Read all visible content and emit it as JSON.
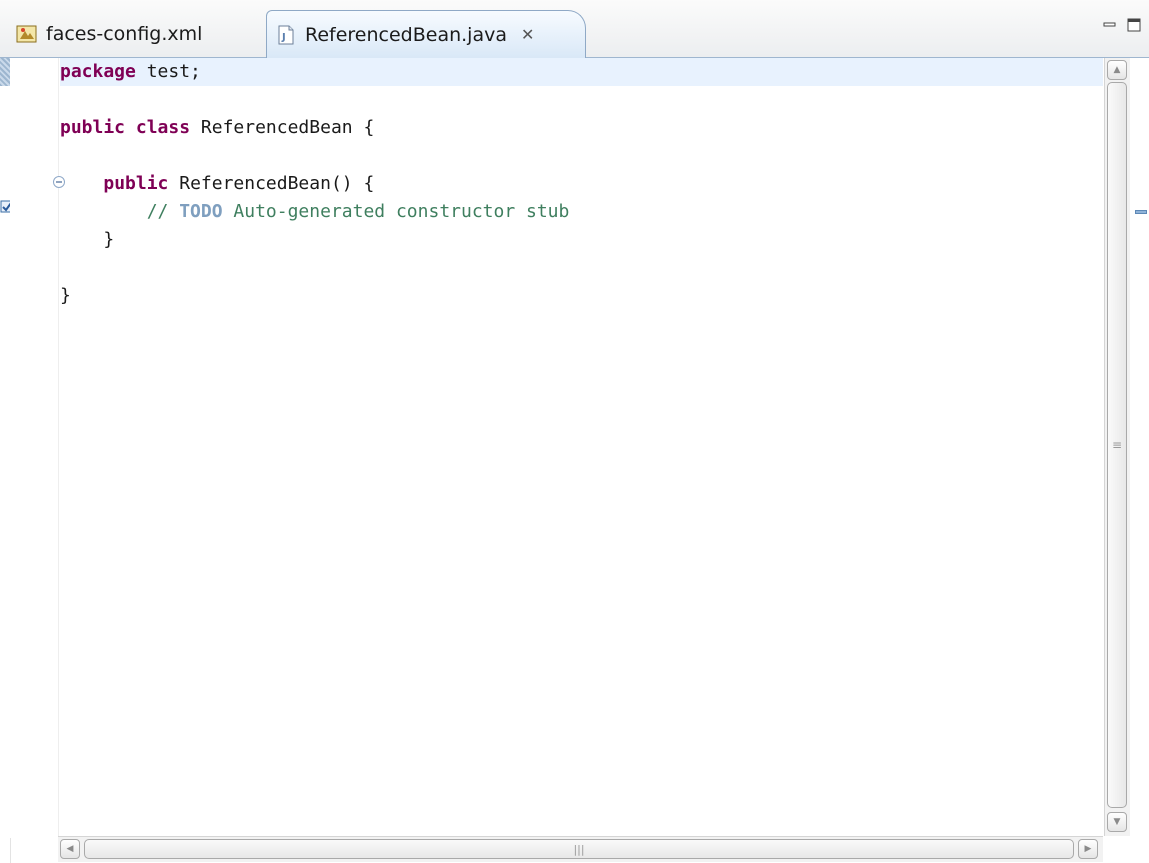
{
  "tabs": [
    {
      "label": "faces-config.xml",
      "icon": "xml-config-icon",
      "active": false
    },
    {
      "label": "ReferencedBean.java",
      "icon": "java-file-icon",
      "active": true,
      "close_glyph": "✕"
    }
  ],
  "view_controls": {
    "minimize": "minimize-icon",
    "maximize": "maximize-icon"
  },
  "code": {
    "line1": {
      "kw": "package",
      "rest": " test;"
    },
    "line3": {
      "kw1": "public",
      "kw2": "class",
      "rest": " ReferencedBean {"
    },
    "line5": {
      "indent": "    ",
      "kw": "public",
      "rest": " ReferencedBean() {"
    },
    "line6": {
      "indent": "        ",
      "comment_prefix": "// ",
      "todo": "TODO",
      "comment_rest": " Auto-generated constructor stub"
    },
    "line7": {
      "text": "    }"
    },
    "line9": {
      "text": "}"
    }
  },
  "colors": {
    "keyword": "#7f0055",
    "comment": "#3f7f5f",
    "todo": "#7f9fbf",
    "current_line": "#e8f2fe"
  }
}
